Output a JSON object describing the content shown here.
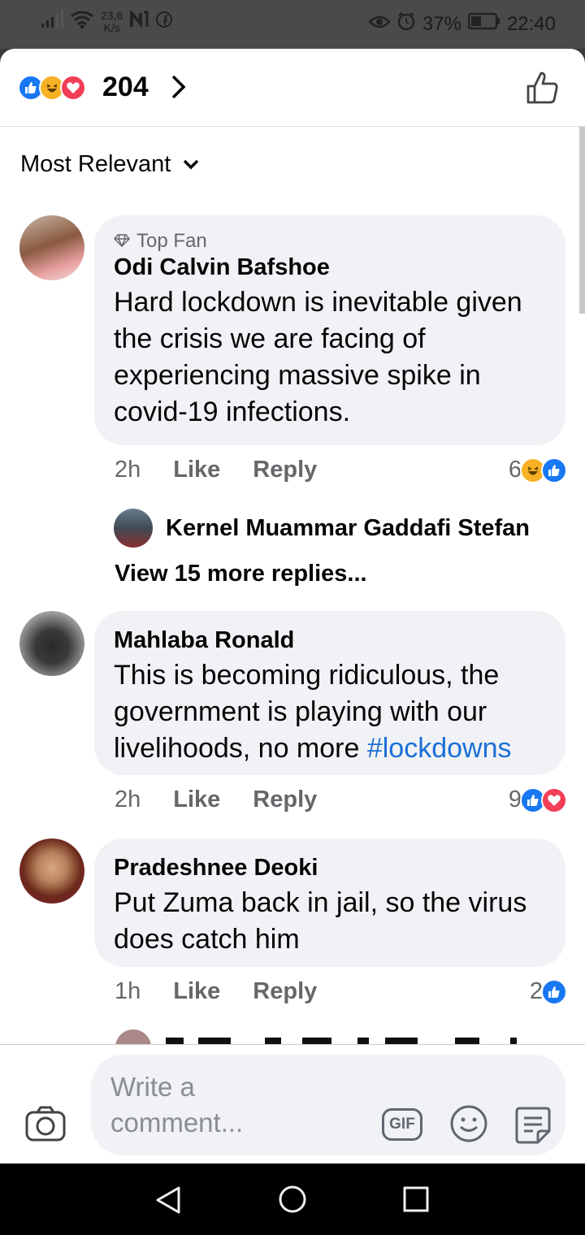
{
  "status_bar": {
    "net_speed_value": "23,6",
    "net_speed_unit": "K/s",
    "battery": "37%",
    "time": "22:40"
  },
  "header": {
    "reaction_count": "204",
    "reaction_icons": [
      "like-icon",
      "haha-icon",
      "love-icon"
    ]
  },
  "sort": {
    "label": "Most Relevant"
  },
  "comments": [
    {
      "badge": "Top Fan",
      "author": "Odi Calvin Bafshoe",
      "text": "Hard lockdown is inevitable given the crisis we are facing of experiencing massive spike in covid-19 infections.",
      "time": "2h",
      "like_label": "Like",
      "reply_label": "Reply",
      "reaction_count": "6",
      "reaction_icons": [
        "haha-icon",
        "like-icon"
      ]
    },
    {
      "author": "Mahlaba Ronald",
      "text": "This is becoming ridiculous, the government is playing with our livelihoods, no more ",
      "hashtag": "#lockdowns",
      "time": "2h",
      "like_label": "Like",
      "reply_label": "Reply",
      "reaction_count": "9",
      "reaction_icons": [
        "like-icon",
        "love-icon"
      ]
    },
    {
      "author": "Pradeshnee Deoki",
      "text": "Put Zuma back in jail, so the virus does catch him",
      "time": "1h",
      "like_label": "Like",
      "reply_label": "Reply",
      "reaction_count": "2",
      "reaction_icons": [
        "like-icon"
      ]
    }
  ],
  "reply_preview": {
    "author": "Kernel Muammar Gaddafi Stefan",
    "view_more": "View 15 more replies..."
  },
  "composer": {
    "placeholder": "Write a comment...",
    "gif_label": "GIF"
  },
  "colors": {
    "like_blue": "#1877f2",
    "love_red": "#f33e58",
    "haha_yellow": "#f7b125",
    "bubble_bg": "#f0f2f5",
    "hashtag_blue": "#1b6fd6"
  }
}
